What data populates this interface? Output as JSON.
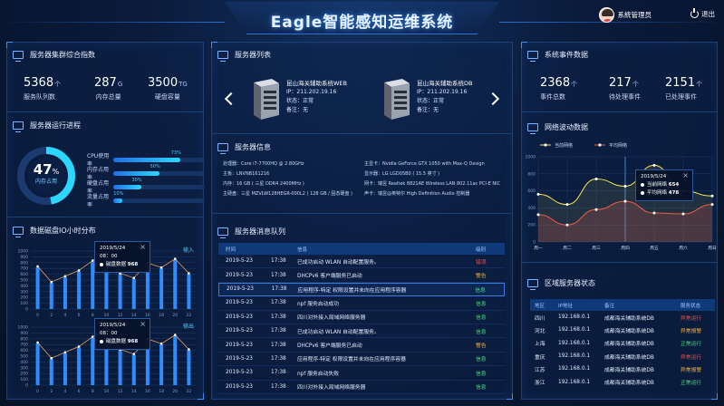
{
  "header": {
    "title": "Eagle智能感知运维系统",
    "user_name": "系統管理员",
    "logout_label": "退出"
  },
  "cluster": {
    "title": "服务器集群综合指数",
    "stats": [
      {
        "value": "5368",
        "unit": "个",
        "label": "服务队列数"
      },
      {
        "value": "287",
        "unit": "G",
        "label": "内存总量"
      },
      {
        "value": "3500",
        "unit": "TG",
        "label": "硬盘容量"
      }
    ]
  },
  "progress": {
    "title": "服务器运行进程",
    "gauge_value": "47",
    "gauge_unit": "%",
    "gauge_label": "内存占用",
    "bars": [
      {
        "label": "CPU使用率",
        "value": 73,
        "pct_label": "73%"
      },
      {
        "label": "内存占用率",
        "value": 50,
        "pct_label": "50%"
      },
      {
        "label": "硬盘占用率",
        "value": 30,
        "pct_label": "30%"
      },
      {
        "label": "流量占用率",
        "value": 10,
        "pct_label": "10%"
      }
    ]
  },
  "disk_io": {
    "title": "数据磁盘IO小时分布",
    "in_label": "输入",
    "out_label": "输出",
    "tooltip_date": "2019/5/24",
    "tooltip_time": "08：00",
    "tooltip_series": "磁盘数据",
    "tooltip_value": "968"
  },
  "chart_data": [
    {
      "type": "bar",
      "ylabel": "",
      "ylim": [
        0,
        1000
      ],
      "yticks": [
        "1000",
        "900",
        "800",
        "700",
        "600",
        "500",
        "400",
        "300",
        "200",
        "100",
        "0"
      ],
      "categories": [
        "0",
        "2",
        "4",
        "6",
        "8",
        "10",
        "12",
        "14",
        "16",
        "18",
        "20",
        "22"
      ],
      "series": [
        {
          "values": [
            720,
            450,
            550,
            650,
            820,
            968,
            600,
            520,
            780,
            700,
            850,
            600
          ]
        }
      ]
    },
    {
      "type": "bar",
      "ylim": [
        0,
        1000
      ],
      "yticks": [
        "1000",
        "900",
        "800",
        "700",
        "600",
        "500",
        "400",
        "300",
        "200",
        "100",
        "0"
      ],
      "categories": [
        "0",
        "2",
        "4",
        "6",
        "8",
        "10",
        "12",
        "14",
        "16",
        "18",
        "20",
        "22"
      ],
      "series": [
        {
          "values": [
            720,
            450,
            550,
            650,
            820,
            968,
            600,
            520,
            780,
            700,
            850,
            600
          ]
        }
      ]
    },
    {
      "type": "line",
      "ylim": [
        0,
        1000
      ],
      "yticks": [
        "1000",
        "800",
        "600",
        "400",
        "200",
        "0"
      ],
      "categories": [
        "周一",
        "周二",
        "周三",
        "周四",
        "周五",
        "周六",
        "周日"
      ],
      "series": [
        {
          "name": "当前网络",
          "values": [
            560,
            440,
            740,
            654,
            900,
            600,
            540
          ],
          "color": "#f0e44a"
        },
        {
          "name": "平均网络",
          "values": [
            320,
            200,
            380,
            478,
            340,
            330,
            440
          ],
          "color": "#f05a4a"
        }
      ]
    }
  ],
  "servers": {
    "title": "服务器列表",
    "list": [
      {
        "name": "昆山海关辅助系统WEB",
        "ip": "IP：211.202.19.16",
        "status": "状态：正常",
        "note": "备注：无"
      },
      {
        "name": "昆山海关辅助系统DB",
        "ip": "IP：211.202.19.16",
        "status": "状态：正常",
        "note": "备注：无"
      }
    ]
  },
  "server_info": {
    "title": "服务器信息",
    "left": [
      "处理器：Core i7-7700HQ @ 2.80GHz",
      "主板：LNVNB161216",
      "内存：16 GB ( 三星 DDR4 2400MHz )",
      "主硬盘：三星 MZVLW128HEGR-000L2 ( 128 GB / 固态硬盘 )"
    ],
    "right": [
      "主显卡：Nvidia GeForce GTX 1050 with Max-Q Design",
      "显示器：LG LGD05B0 ( 15.5 英寸 )",
      "网卡：瑞昱 Realtek 8821AE Wireless LAN 802.11ac PCI-E NIC",
      "声卡：瑞昱@英特尔 High Definition Audio 控制器"
    ]
  },
  "queue": {
    "title": "服务器消息队列",
    "headers": [
      "时间",
      "信息",
      "级别"
    ],
    "rows": [
      {
        "date": "2019-5-23",
        "time": "17:38",
        "msg": "已成功启动 WLAN 自动配置服务。",
        "level": "错误",
        "color": "#ff4a4a"
      },
      {
        "date": "2019-5-23",
        "time": "17:38",
        "msg": "DHCPv6 客户端服务已启动",
        "level": "警告",
        "color": "#ffb030"
      },
      {
        "date": "2019-5-23",
        "time": "17:38",
        "msg": "应用程序-特定 权限设置并未向在应用程序容器",
        "level": "信息",
        "color": "#3ee07a"
      },
      {
        "date": "2019-5-23",
        "time": "17:38",
        "msg": "npf 服务启动成功",
        "level": "信息",
        "color": "#3ee07a"
      },
      {
        "date": "2019-5-23",
        "time": "17:38",
        "msg": "四川对外接入局域网络服务器",
        "level": "信息",
        "color": "#3ee07a"
      },
      {
        "date": "2019-5-23",
        "time": "17:38",
        "msg": "已成功启动 WLAN 自动配置服务。",
        "level": "信息",
        "color": "#3ee07a"
      },
      {
        "date": "2019-5-23",
        "time": "17:38",
        "msg": "DHCPv6 客户端服务已启动",
        "level": "警告",
        "color": "#ffb030"
      },
      {
        "date": "2019-5-23",
        "time": "17:38",
        "msg": "应用程序-特定 权限设置并未向在应用程序容器",
        "level": "信息",
        "color": "#3ee07a"
      },
      {
        "date": "2019-5-23",
        "time": "17:38",
        "msg": "npf 服务启动失败",
        "level": "信息",
        "color": "#3ee07a"
      },
      {
        "date": "2019-5-23",
        "time": "17:38",
        "msg": "四川对外接入局域网络服务器",
        "level": "信息",
        "color": "#3ee07a"
      }
    ]
  },
  "events": {
    "title": "系统事件数据",
    "stats": [
      {
        "value": "2368",
        "unit": "个",
        "label": "事件总数"
      },
      {
        "value": "217",
        "unit": "个",
        "label": "待处理事件"
      },
      {
        "value": "2151",
        "unit": "个",
        "label": "已处理事件"
      }
    ]
  },
  "network": {
    "title": "网络波动数据",
    "legend_current": "当前网络",
    "legend_avg": "平均网络",
    "tooltip_date": "2019/5/24",
    "tooltip_line1_label": "当前网络",
    "tooltip_line1_value": "654",
    "tooltip_line2_label": "平均网络",
    "tooltip_line2_value": "478"
  },
  "region": {
    "title": "区域服务器状态",
    "headers": [
      "地区",
      "IP地址",
      "备注",
      "服务状态"
    ],
    "rows": [
      {
        "area": "四川",
        "ip": "192.168.0.1",
        "note": "成都海关辅助系统DB",
        "status": "异常运行",
        "color": "#ff4a4a"
      },
      {
        "area": "河北",
        "ip": "192.168.0.1",
        "note": "成都海关辅助系统DB",
        "status": "异常报警",
        "color": "#ffb030"
      },
      {
        "area": "上海",
        "ip": "192.168.0.1",
        "note": "成都海关辅助系统DB",
        "status": "正常运行",
        "color": "#3ee07a"
      },
      {
        "area": "重庆",
        "ip": "192.168.0.1",
        "note": "成都海关辅助系统DB",
        "status": "异常运行",
        "color": "#ff4a4a"
      },
      {
        "area": "江苏",
        "ip": "192.168.0.1",
        "note": "成都海关辅助系统DB",
        "status": "异常报警",
        "color": "#ffb030"
      },
      {
        "area": "浙江",
        "ip": "192.168.0.1",
        "note": "成都海关辅助系统DB",
        "status": "正常运行",
        "color": "#3ee07a"
      }
    ]
  }
}
